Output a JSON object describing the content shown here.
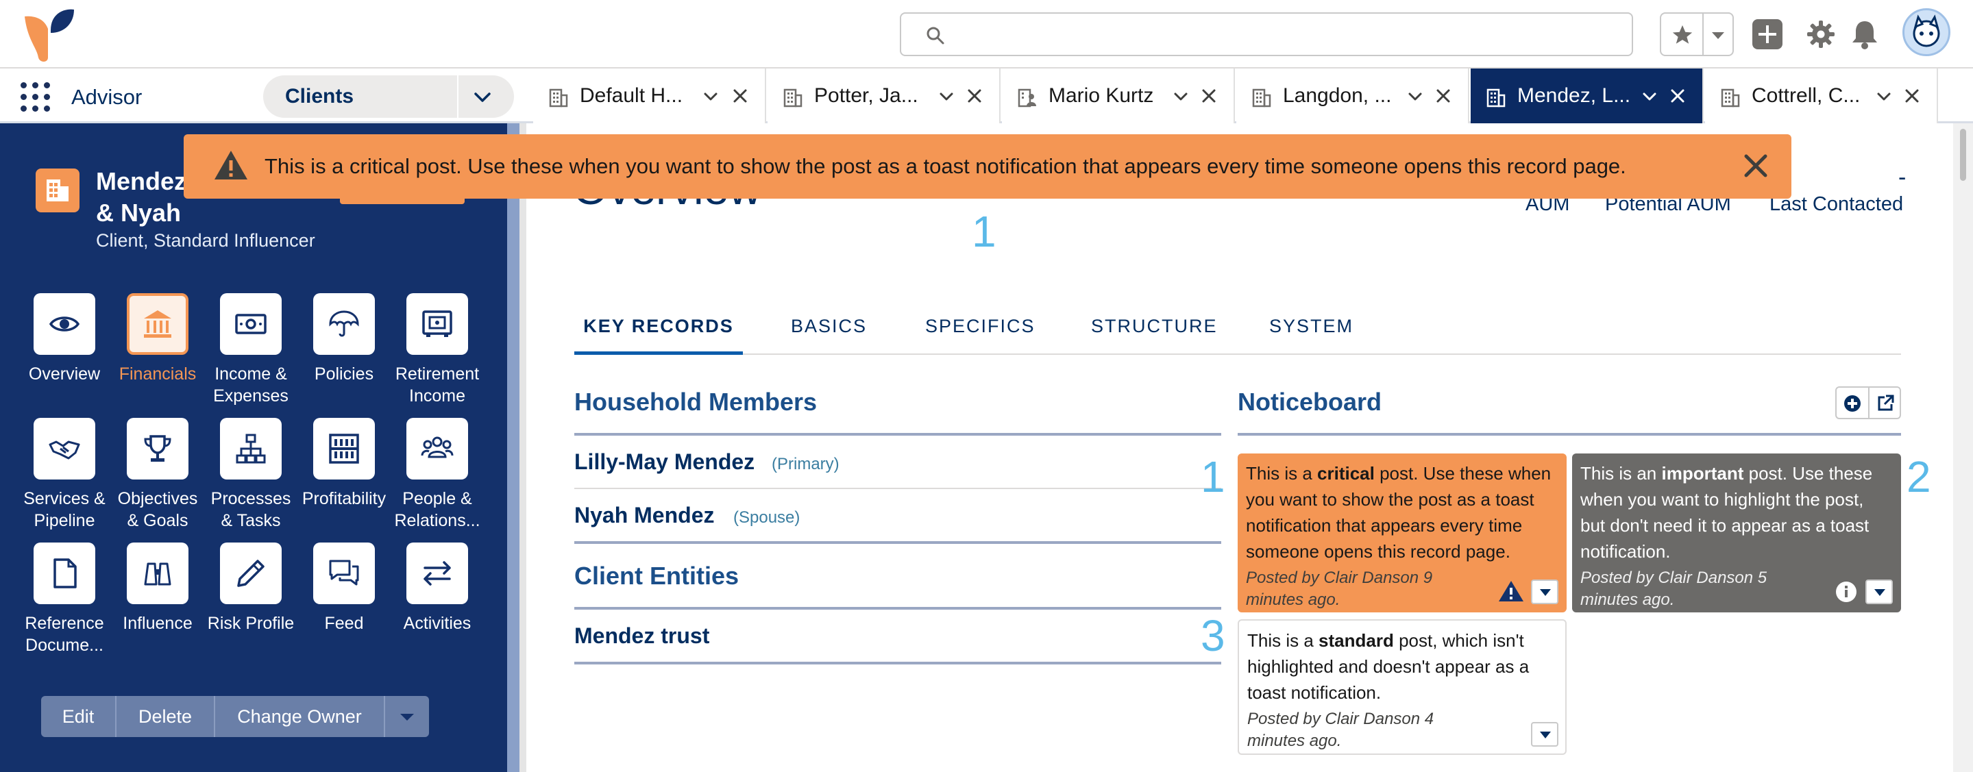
{
  "header": {
    "search_placeholder": "",
    "icons": [
      "brand-logo",
      "search-icon",
      "star-icon",
      "chevron-down-icon",
      "add-icon",
      "gear-icon",
      "bell-icon",
      "avatar"
    ]
  },
  "nav": {
    "app_name": "Advisor",
    "object_select": "Clients",
    "tabs": [
      {
        "label": "Default H...",
        "icon": "building-icon",
        "active": false
      },
      {
        "label": "Potter, Ja...",
        "icon": "building-icon",
        "active": false
      },
      {
        "label": "Mario Kurtz",
        "icon": "person-icon",
        "active": false
      },
      {
        "label": "Langdon, ...",
        "icon": "building-icon",
        "active": false
      },
      {
        "label": "Mendez, L...",
        "icon": "building-icon",
        "active": true
      },
      {
        "label": "Cottrell, C...",
        "icon": "building-icon",
        "active": false
      }
    ]
  },
  "toast": {
    "message": "This is a critical post. Use these when you want to show the post as a toast notification that appears every time someone opens this record page."
  },
  "record": {
    "name_line1": "Mendez",
    "name_line2": "& Nyah",
    "subtitle": "Client, Standard Influencer"
  },
  "sidebar": {
    "tiles": [
      {
        "label": "Overview",
        "icon": "eye-icon"
      },
      {
        "label": "Financials",
        "icon": "bank-icon",
        "active": true
      },
      {
        "label": "Income &\nExpenses",
        "icon": "money-icon"
      },
      {
        "label": "Policies",
        "icon": "umbrella-icon"
      },
      {
        "label": "Retirement\nIncome",
        "icon": "safe-icon"
      },
      {
        "label": "Services &\nPipeline",
        "icon": "handshake-icon"
      },
      {
        "label": "Objectives\n& Goals",
        "icon": "trophy-icon"
      },
      {
        "label": "Processes\n& Tasks",
        "icon": "hierarchy-icon"
      },
      {
        "label": "Profitability",
        "icon": "abacus-icon"
      },
      {
        "label": "People &\nRelations...",
        "icon": "people-icon"
      },
      {
        "label": "Reference\nDocume...",
        "icon": "document-icon"
      },
      {
        "label": "Influence",
        "icon": "binoculars-icon"
      },
      {
        "label": "Risk Profile",
        "icon": "pencil-icon"
      },
      {
        "label": "Feed",
        "icon": "chat-icon"
      },
      {
        "label": "Activities",
        "icon": "swap-icon"
      }
    ],
    "actions": {
      "edit": "Edit",
      "delete": "Delete",
      "change_owner": "Change Owner"
    }
  },
  "main": {
    "title": "Overview",
    "kpis": {
      "dash": "-",
      "aum": "AUM",
      "potential_aum": "Potential AUM",
      "last_contacted": "Last Contacted"
    },
    "callout_numbers": {
      "n1_top": "1",
      "n1": "1",
      "n2": "2",
      "n3": "3"
    },
    "tabs": [
      "KEY RECORDS",
      "BASICS",
      "SPECIFICS",
      "STRUCTURE",
      "SYSTEM"
    ],
    "household": {
      "title": "Household Members",
      "members": [
        {
          "name": "Lilly-May Mendez",
          "role": "(Primary)"
        },
        {
          "name": "Nyah Mendez",
          "role": "(Spouse)"
        }
      ]
    },
    "entities": {
      "title": "Client Entities",
      "items": [
        "Mendez trust"
      ]
    },
    "noticeboard": {
      "title": "Noticeboard",
      "posts": [
        {
          "type": "critical",
          "pre": "This is a ",
          "bold": "critical",
          "post": " post. Use these when you want to show the post as a toast notification that appears every time someone opens this record page.",
          "meta": "Posted by Clair Danson 9 minutes ago."
        },
        {
          "type": "important",
          "pre": "This is an ",
          "bold": "important",
          "post": " post. Use these when you want to highlight the post, but don't need it to appear as a toast notification.",
          "meta": "Posted by Clair Danson 5 minutes ago."
        },
        {
          "type": "standard",
          "pre": "This is a ",
          "bold": "standard",
          "post": " post, which isn't highlighted and doesn't appear as a toast notification.",
          "meta": "Posted by Clair Danson 4 minutes ago."
        }
      ]
    }
  },
  "colors": {
    "brand_navy": "#14316b",
    "active_tab": "#0b2a63",
    "accent_orange": "#f49654",
    "important_gray": "#6b6a68",
    "callout_blue": "#5bb9e8"
  }
}
